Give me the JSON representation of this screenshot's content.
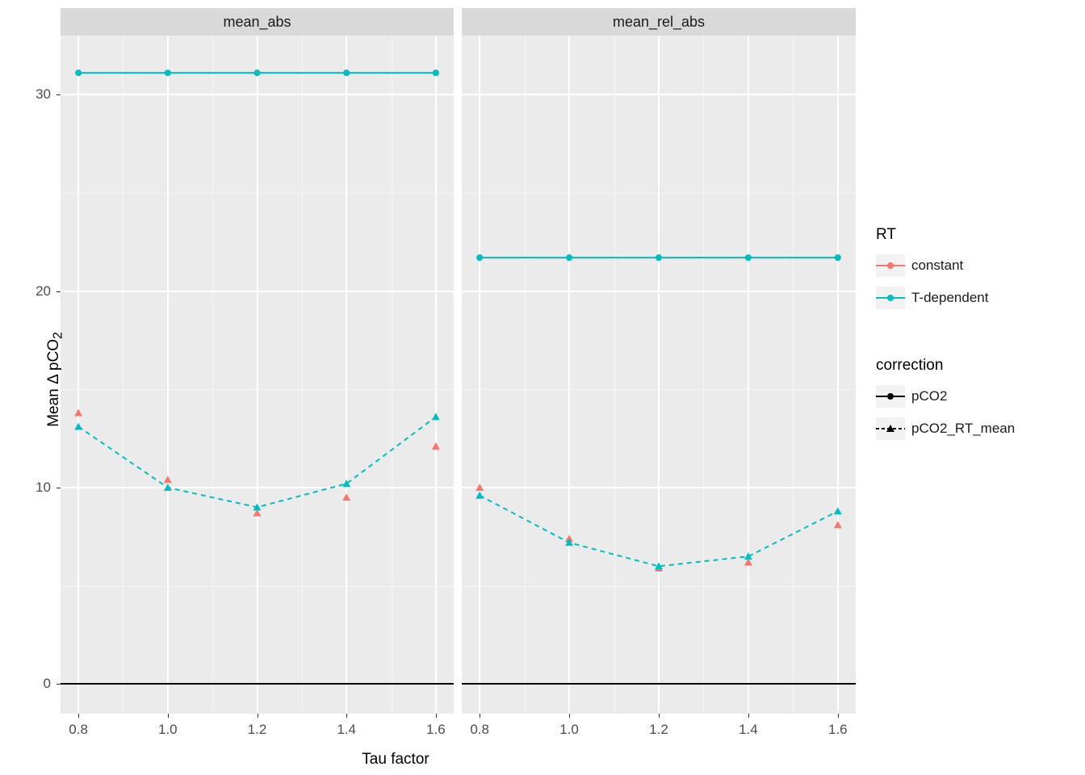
{
  "chart_data": {
    "type": "line",
    "xlabel": "Tau factor",
    "ylabel_plain": "Mean Δ pCO2",
    "ylim": [
      -1.5,
      33
    ],
    "xlim": [
      0.76,
      1.64
    ],
    "x": [
      0.8,
      1.0,
      1.2,
      1.4,
      1.6
    ],
    "facets": [
      "mean_abs",
      "mean_rel_abs"
    ],
    "legend_rt_title": "RT",
    "legend_rt": [
      "constant",
      "T-dependent"
    ],
    "legend_corr_title": "correction",
    "legend_corr": [
      "pCO2",
      "pCO2_RT_mean"
    ],
    "colors": {
      "constant": "#F8766D",
      "T-dependent": "#00BFC4"
    },
    "series": [
      {
        "facet": "mean_abs",
        "rt": "constant",
        "corr": "pCO2",
        "y": [
          31.1,
          31.1,
          31.1,
          31.1,
          31.1
        ]
      },
      {
        "facet": "mean_abs",
        "rt": "T-dependent",
        "corr": "pCO2",
        "y": [
          31.1,
          31.1,
          31.1,
          31.1,
          31.1
        ]
      },
      {
        "facet": "mean_abs",
        "rt": "constant",
        "corr": "pCO2_RT_mean",
        "y": [
          13.8,
          10.4,
          8.7,
          9.5,
          12.1
        ]
      },
      {
        "facet": "mean_abs",
        "rt": "T-dependent",
        "corr": "pCO2_RT_mean",
        "y": [
          13.1,
          10.0,
          9.0,
          10.2,
          13.6
        ]
      },
      {
        "facet": "mean_rel_abs",
        "rt": "constant",
        "corr": "pCO2",
        "y": [
          21.7,
          21.7,
          21.7,
          21.7,
          21.7
        ]
      },
      {
        "facet": "mean_rel_abs",
        "rt": "T-dependent",
        "corr": "pCO2",
        "y": [
          21.7,
          21.7,
          21.7,
          21.7,
          21.7
        ]
      },
      {
        "facet": "mean_rel_abs",
        "rt": "constant",
        "corr": "pCO2_RT_mean",
        "y": [
          10.0,
          7.4,
          5.9,
          6.2,
          8.1
        ]
      },
      {
        "facet": "mean_rel_abs",
        "rt": "T-dependent",
        "corr": "pCO2_RT_mean",
        "y": [
          9.6,
          7.2,
          6.0,
          6.5,
          8.8
        ]
      }
    ],
    "y_ticks": [
      0,
      10,
      20,
      30
    ],
    "x_ticks": [
      0.8,
      1.0,
      1.2,
      1.4,
      1.6
    ],
    "x_tick_labels": [
      "0.8",
      "1.0",
      "1.2",
      "1.4",
      "1.6"
    ]
  }
}
